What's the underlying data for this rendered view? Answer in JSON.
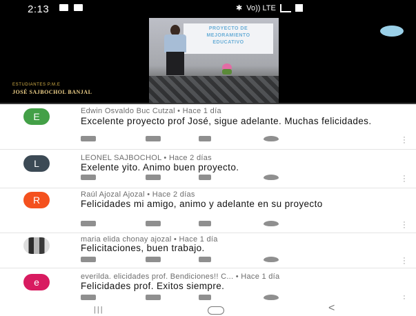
{
  "status": {
    "time": "2:13",
    "network": "Vo)) LTE",
    "network2": "LTE1"
  },
  "video": {
    "banner_text": "PROYECTO DE\nMEJORAMIENTO\nEDUCATIVO",
    "channel_logo": "",
    "overlay_line1": "ESTUDIANTES P.M.E",
    "overlay_line2": "JOSÉ SAJBOCHOL BANJAL",
    "progress": 0.0
  },
  "comments": [
    {
      "avatar_letter": "E",
      "avatar_color": "#43a047",
      "meta": "Edwin Osvaldo Buc Cutzal • Hace 1 día",
      "text": "Excelente proyecto prof José, sigue adelante. Muchas felicidades."
    },
    {
      "avatar_letter": "L",
      "avatar_color": "#3c4a55",
      "meta": "LEONEL SAJBOCHOL • Hace 2 días",
      "text": "Exelente yito. Animo buen proyecto."
    },
    {
      "avatar_letter": "R",
      "avatar_color": "#f4511e",
      "meta": "Raúl Ajozal Ajozal • Hace 2 días",
      "text": "Felicidades mi amigo, animo y adelante en su proyecto"
    },
    {
      "avatar_letter": "",
      "avatar_color": "#cfcfcf",
      "meta": "maria elida chonay ajozal • Hace 1 día",
      "text": "Felicitaciones, buen trabajo."
    },
    {
      "avatar_letter": "e",
      "avatar_color": "#d81b60",
      "meta": "everilda. elicidades prof. Bendiciones!! C... • Hace 1 día",
      "text": "Felicidades prof. Exitos siempre."
    }
  ],
  "icons": {
    "like": "thumb-up-icon",
    "dislike": "thumb-down-icon",
    "reply": "reply-icon",
    "heart": "heart-icon",
    "more": "more-vert-icon"
  },
  "navbar": {
    "recent": "|||",
    "back": "<"
  }
}
